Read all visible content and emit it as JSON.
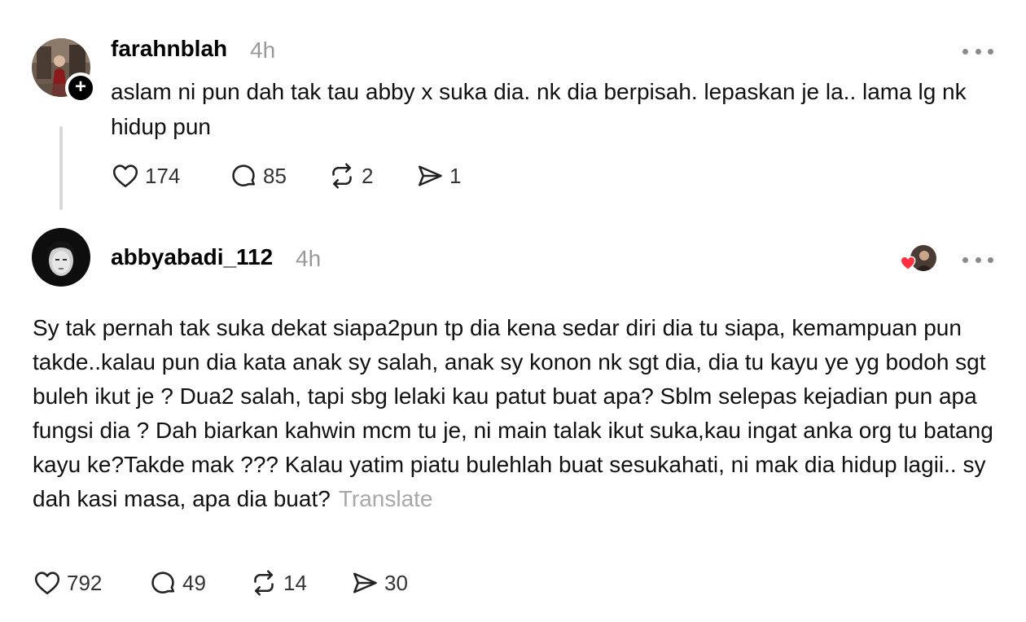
{
  "posts": [
    {
      "username": "farahnblah",
      "time": "4h",
      "text": "aslam ni pun dah tak tau abby x suka dia. nk dia berpisah. lepaskan je la.. lama lg nk hidup pun",
      "likes": "174",
      "replies": "85",
      "reposts": "2",
      "shares": "1",
      "has_follow_badge": true
    },
    {
      "username": "abbyabadi_112",
      "time": "4h",
      "text": "Sy tak pernah tak suka dekat siapa2pun tp dia kena sedar diri dia tu siapa, kemampuan pun takde..kalau pun dia kata anak sy salah, anak sy konon nk sgt dia, dia tu kayu ye yg bodoh sgt buleh ikut je ? Dua2 salah, tapi sbg lelaki kau patut buat apa? Sblm selepas kejadian pun apa fungsi dia ? Dah biarkan kahwin mcm tu je, ni main talak ikut suka,kau ingat anka org tu batang kayu ke?Takde mak ??? Kalau yatim piatu bulehlah buat sesukahati, ni mak dia hidup lagii.. sy dah kasi masa, apa dia buat?",
      "translate_label": "Translate",
      "likes": "792",
      "replies": "49",
      "reposts": "14",
      "shares": "30"
    }
  ],
  "icons": {
    "like": "heart-outline-icon",
    "reply": "speech-bubble-icon",
    "repost": "repost-arrows-icon",
    "share": "paper-plane-icon",
    "more": "three-dots-icon",
    "follow": "plus-badge-icon",
    "liked_by_author": "red-heart-icon"
  },
  "colors": {
    "text": "#111111",
    "muted": "#999999",
    "translate": "#a8a8a8",
    "thread_line": "#d9d9d9",
    "heart_red": "#ff3040"
  }
}
